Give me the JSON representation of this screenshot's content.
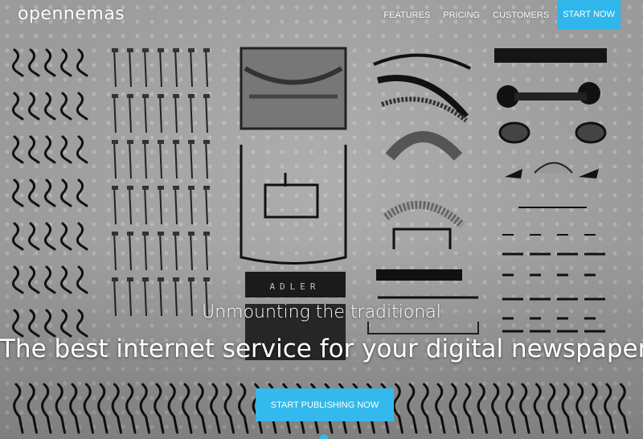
{
  "brand": {
    "logo_text": "opennemas"
  },
  "nav": {
    "items": [
      {
        "label": "FEATURES"
      },
      {
        "label": "PRICING"
      },
      {
        "label": "CUSTOMERS"
      }
    ],
    "cta_label": "START NOW",
    "accent_color": "#2fb6ea"
  },
  "hero": {
    "tagline": "Unmounting the traditional",
    "headline": "The best internet service for your digital newspaper",
    "cta_label": "START PUBLISHING NOW",
    "plate_text": "ADLER",
    "background_image": "disassembled-typewriter-photo"
  }
}
